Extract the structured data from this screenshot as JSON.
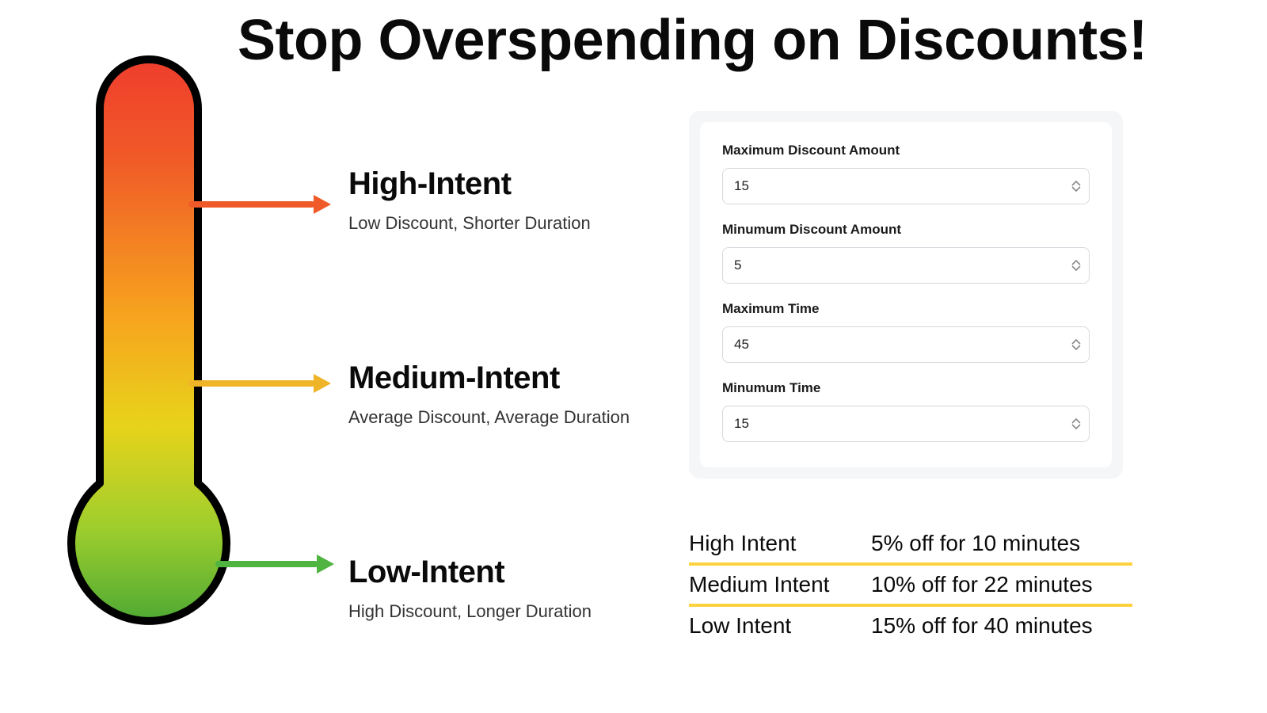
{
  "title": "Stop Overspending on Discounts!",
  "labels": [
    {
      "title": "High-Intent",
      "sub": "Low Discount, Shorter Duration",
      "color": "#f05a28"
    },
    {
      "title": "Medium-Intent",
      "sub": "Average Discount, Average Duration",
      "color": "#f0b428"
    },
    {
      "title": "Low-Intent",
      "sub": "High Discount, Longer Duration",
      "color": "#4fb440"
    }
  ],
  "form": {
    "fields": [
      {
        "label": "Maximum Discount Amount",
        "value": "15"
      },
      {
        "label": "Minumum Discount Amount",
        "value": "5"
      },
      {
        "label": "Maximum Time",
        "value": "45"
      },
      {
        "label": "Minumum Time",
        "value": "15"
      }
    ]
  },
  "summary": [
    {
      "label": "High Intent",
      "value": "5% off for 10 minutes"
    },
    {
      "label": "Medium Intent",
      "value": "10% off for 22 minutes"
    },
    {
      "label": "Low Intent",
      "value": "15% off for 40 minutes"
    }
  ],
  "colors": {
    "accentDivider": "#ffd23f"
  }
}
